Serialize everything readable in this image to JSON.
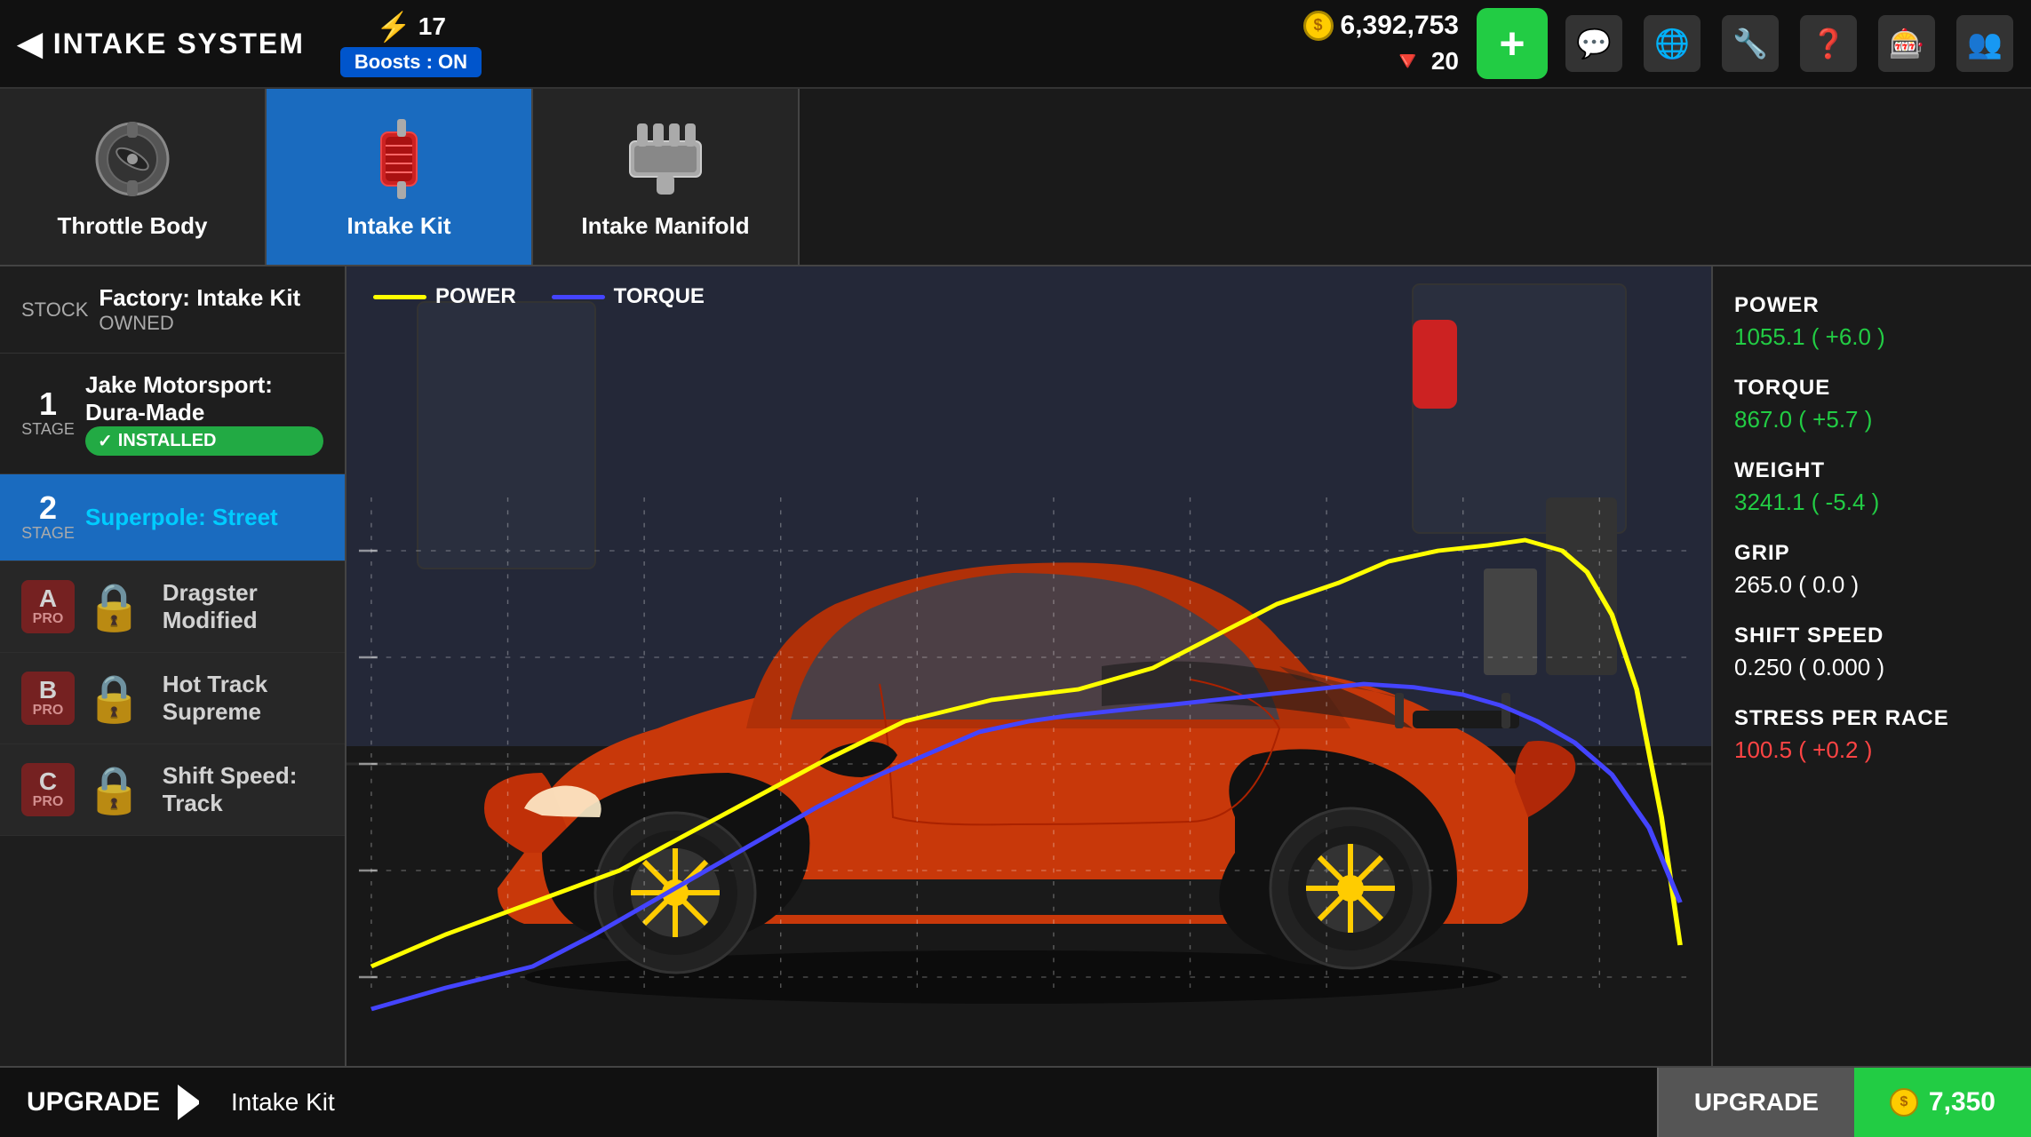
{
  "header": {
    "back_label": "INTAKE SYSTEM",
    "bolt_count": "17",
    "boosts_label": "Boosts : ON",
    "gold_amount": "6,392,753",
    "diamond_amount": "20",
    "add_label": "+"
  },
  "nav_icons": [
    "💬",
    "🌐",
    "🔧",
    "❓",
    "🎰",
    "👥"
  ],
  "tabs": [
    {
      "label": "Throttle Body",
      "active": false,
      "icon": "throttle"
    },
    {
      "label": "Intake Kit",
      "active": true,
      "icon": "intake_kit"
    },
    {
      "label": "Intake Manifold",
      "active": false,
      "icon": "manifold"
    }
  ],
  "upgrades": [
    {
      "id": "stock",
      "stage_num": "",
      "stage_label": "STOCK",
      "name": "Factory: Intake Kit",
      "sub": "OWNED",
      "status": "owned",
      "locked": false,
      "selected": false,
      "pro": null
    },
    {
      "id": "stage1",
      "stage_num": "1",
      "stage_label": "STAGE",
      "name": "Jake Motorsport: Dura-Made",
      "sub": "",
      "status": "installed",
      "locked": false,
      "selected": false,
      "pro": null
    },
    {
      "id": "stage2",
      "stage_num": "2",
      "stage_label": "STAGE",
      "name": "Superpole: Street",
      "sub": "",
      "status": "selected",
      "locked": false,
      "selected": true,
      "pro": null
    },
    {
      "id": "proA",
      "stage_num": "A",
      "stage_label": "PRO",
      "name": "Dragster Modified",
      "sub": "",
      "status": "locked",
      "locked": true,
      "selected": false,
      "pro": "A"
    },
    {
      "id": "proB",
      "stage_num": "B",
      "stage_label": "PRO",
      "name": "Hot Track Supreme",
      "sub": "",
      "status": "locked",
      "locked": true,
      "selected": false,
      "pro": "B"
    },
    {
      "id": "proC",
      "stage_num": "C",
      "stage_label": "PRO",
      "name": "Shift Speed: Track",
      "sub": "",
      "status": "locked",
      "locked": true,
      "selected": false,
      "pro": "C"
    }
  ],
  "chart": {
    "power_label": "POWER",
    "torque_label": "TORQUE"
  },
  "stats": [
    {
      "name": "POWER",
      "value": "1055.1 ( +6.0 )",
      "type": "positive"
    },
    {
      "name": "TORQUE",
      "value": "867.0 ( +5.7 )",
      "type": "positive"
    },
    {
      "name": "WEIGHT",
      "value": "3241.1 ( -5.4 )",
      "type": "positive"
    },
    {
      "name": "GRIP",
      "value": "265.0 ( 0.0 )",
      "type": "neutral"
    },
    {
      "name": "SHIFT SPEED",
      "value": "0.250 ( 0.000 )",
      "type": "neutral"
    },
    {
      "name": "STRESS PER RACE",
      "value": "100.5 ( +0.2 )",
      "type": "negative"
    }
  ],
  "bottom_bar": {
    "upgrade_label": "UPGRADE",
    "part_name": "Intake Kit",
    "upgrade_btn_label": "UPGRADE",
    "price": "7,350"
  }
}
